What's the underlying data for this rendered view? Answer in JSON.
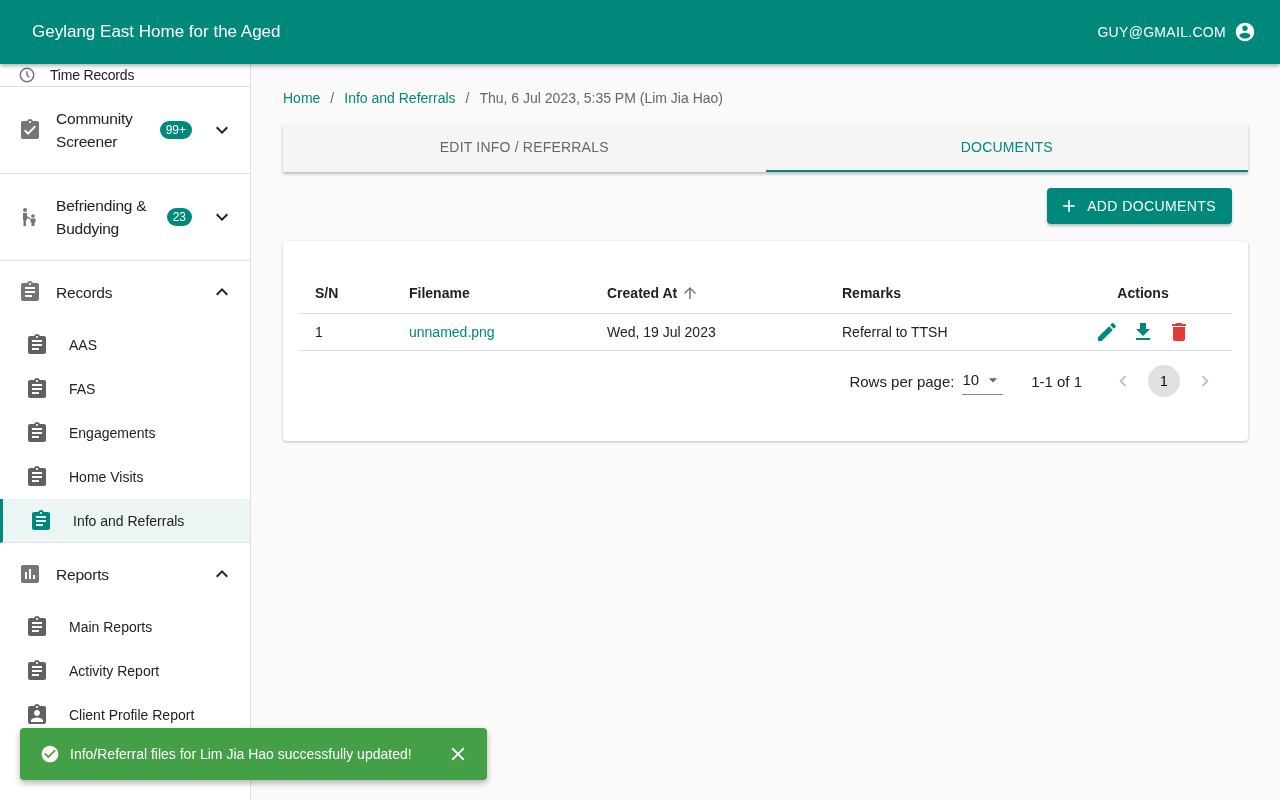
{
  "header": {
    "title": "Geylang East Home for the Aged",
    "user": "GUY@GMAIL.COM"
  },
  "sidebar": {
    "sections": [
      {
        "label": "Time Records",
        "kind": "clock"
      },
      {
        "label": "Community Screener",
        "kind": "check",
        "badge": "99+",
        "expanded": false
      },
      {
        "label": "Befriending & Buddying",
        "kind": "family",
        "badge": "23",
        "expanded": false
      },
      {
        "label": "Records",
        "kind": "document",
        "expanded": true,
        "children": [
          {
            "label": "AAS",
            "kind": "document",
            "selected": false
          },
          {
            "label": "FAS",
            "kind": "document",
            "selected": false
          },
          {
            "label": "Engagements",
            "kind": "document",
            "selected": false
          },
          {
            "label": "Home Visits",
            "kind": "document",
            "selected": false
          },
          {
            "label": "Info and Referrals",
            "kind": "document",
            "selected": true
          }
        ]
      },
      {
        "label": "Reports",
        "kind": "chart",
        "expanded": true,
        "children": [
          {
            "label": "Main Reports",
            "kind": "document",
            "selected": false
          },
          {
            "label": "Activity Report",
            "kind": "document",
            "selected": false
          },
          {
            "label": "Client Profile Report",
            "kind": "person",
            "selected": false
          }
        ]
      }
    ]
  },
  "breadcrumb": [
    {
      "label": "Home",
      "kind": "link"
    },
    {
      "label": "/",
      "kind": "separator"
    },
    {
      "label": "Info and Referrals",
      "kind": "link"
    },
    {
      "label": "/",
      "kind": "separator"
    },
    {
      "label": "Thu, 6 Jul 2023, 5:35 PM (Lim Jia Hao)",
      "kind": "current"
    }
  ],
  "tabs": [
    {
      "label": "EDIT INFO / REFERRALS",
      "selected": false
    },
    {
      "label": "DOCUMENTS",
      "selected": true
    }
  ],
  "add_button": {
    "label": "ADD DOCUMENTS"
  },
  "table": {
    "columns": [
      {
        "label": "S/N"
      },
      {
        "label": "Filename"
      },
      {
        "label": "Created At",
        "sorted": true
      },
      {
        "label": "Remarks"
      },
      {
        "label": "Actions"
      }
    ],
    "rows": [
      {
        "sn": "1",
        "filename": "unnamed.png",
        "created_at": "Wed, 19 Jul 2023",
        "remarks": "Referral to TTSH",
        "actions": [
          {
            "kind": "edit"
          },
          {
            "kind": "download"
          },
          {
            "kind": "delete"
          }
        ]
      }
    ],
    "pagination": {
      "rows_per_page_label": "Rows per page:",
      "rows_per_page": "10",
      "range": "1-1 of 1",
      "page": "1",
      "prev_disabled": true,
      "next_disabled": true
    }
  },
  "snackbar": {
    "message": "Info/Referral files for Lim Jia Hao successfully updated!"
  }
}
